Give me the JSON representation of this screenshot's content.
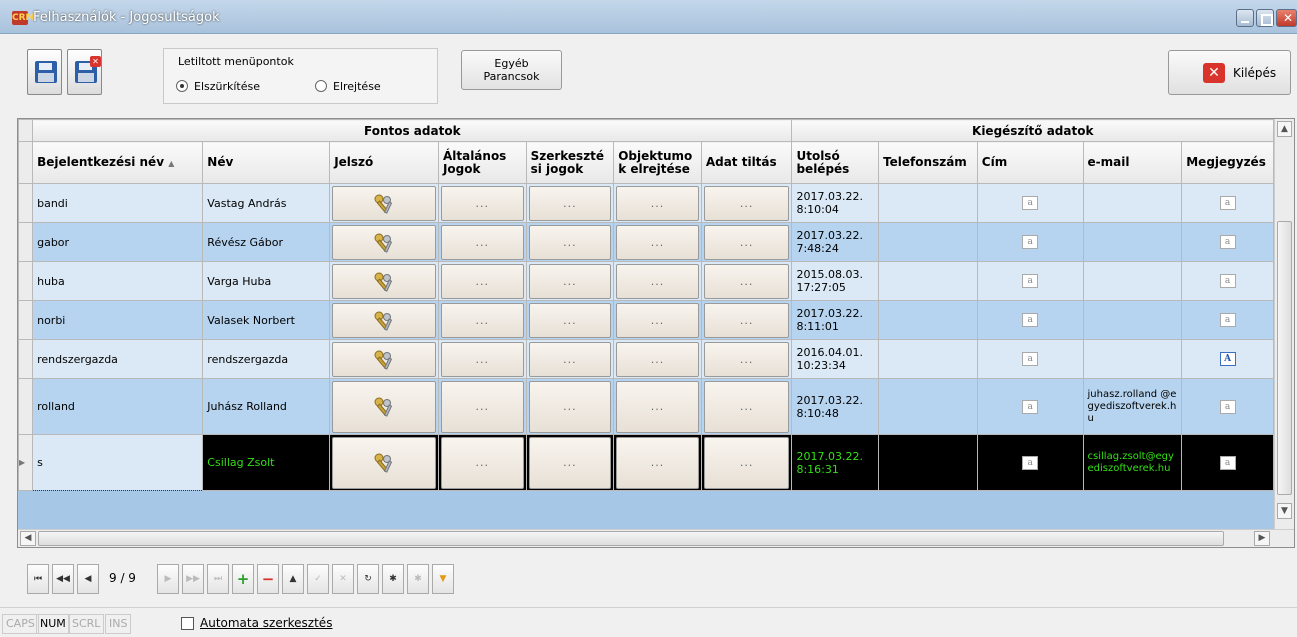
{
  "window": {
    "title": "Felhasználók - Jogosultságok",
    "app_icon": "CRM"
  },
  "toolbar": {
    "menu_box_label": "Letiltott menüpontok",
    "radio_gray": "Elszürkítése",
    "radio_hide": "Elrejtése",
    "selected_radio": "Elszürkítése",
    "more_commands": "Egyéb Parancsok",
    "exit": "Kilépés"
  },
  "grid": {
    "band_main": "Fontos adatok",
    "band_extra": "Kiegészítő adatok",
    "columns": {
      "login": "Bejelentkezési név",
      "name": "Név",
      "password": "Jelszó",
      "general": "Általános Jogok",
      "editor": "Szerkesztési jogok",
      "objects": "Objektumok elrejtése",
      "data_block": "Adat tiltás",
      "last_login": "Utolsó belépés",
      "phone": "Telefonszám",
      "address": "Cím",
      "email": "e-mail",
      "note": "Megjegyzés"
    },
    "sort_indicator": "▲",
    "ellipsis": "...",
    "rows": [
      {
        "login": "bandi",
        "name": "Vastag András",
        "last_login": "2017.03.22. 8:10:04",
        "phone": "",
        "email": "",
        "note_filled": false
      },
      {
        "login": "gabor",
        "name": "Révész Gábor",
        "last_login": "2017.03.22. 7:48:24",
        "phone": "",
        "email": "",
        "note_filled": false
      },
      {
        "login": "huba",
        "name": "Varga Huba",
        "last_login": "2015.08.03. 17:27:05",
        "phone": "",
        "email": "",
        "note_filled": false
      },
      {
        "login": "norbi",
        "name": "Valasek Norbert",
        "last_login": "2017.03.22. 8:11:01",
        "phone": "",
        "email": "",
        "note_filled": false
      },
      {
        "login": "rendszergazda",
        "name": "rendszergazda",
        "last_login": "2016.04.01. 10:23:34",
        "phone": "",
        "email": "",
        "note_filled": true
      },
      {
        "login": "rolland",
        "name": "Juhász Rolland",
        "last_login": "2017.03.22. 8:10:48",
        "phone": "",
        "email": "juhasz.rolland @egyediszoftverek.hu",
        "note_filled": false
      },
      {
        "login": "s",
        "name": "Csillag Zsolt",
        "last_login": "2017.03.22. 8:16:31",
        "phone": "",
        "email": "csillag.zsolt@egyediszoftverek.hu",
        "note_filled": false
      }
    ]
  },
  "navigator": {
    "position": "9 / 9"
  },
  "status": {
    "caps": "CAPS",
    "num": "NUM",
    "scrl": "SCRL",
    "ins": "INS",
    "auto_edit": "Automata szerkesztés"
  },
  "colors": {
    "selected_row_bg": "#000000",
    "selected_row_text": "#34e016",
    "row_light": "#dbe9f6",
    "row_dark": "#b6d4ef"
  }
}
